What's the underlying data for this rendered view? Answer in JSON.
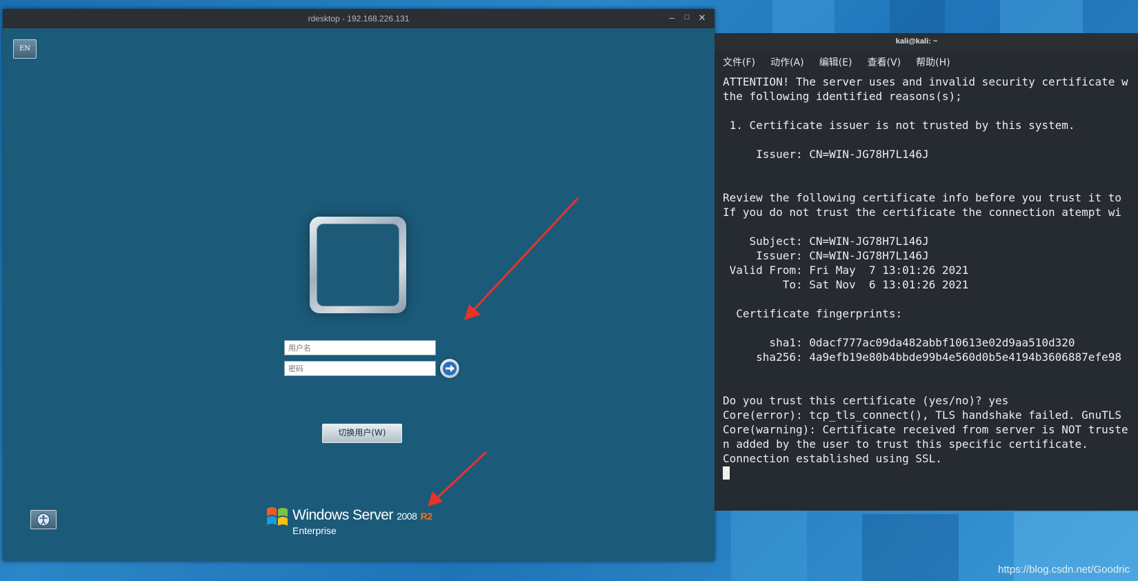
{
  "rdesktop": {
    "title": "rdesktop - 192.168.226.131",
    "controls": {
      "minimize": "–",
      "maximize": "□",
      "close": "✕"
    },
    "lang_button": "EN",
    "username_placeholder": "用户名",
    "password_placeholder": "密码",
    "switch_user_label": "切换用户(W)",
    "brand": {
      "name": "Windows Server",
      "version": "2008",
      "release": "R2",
      "edition": "Enterprise"
    }
  },
  "terminal": {
    "title": "kali@kali: ~",
    "menu": [
      "文件(F)",
      "动作(A)",
      "编辑(E)",
      "查看(V)",
      "帮助(H)"
    ],
    "lines": [
      "ATTENTION! The server uses and invalid security certificate w",
      "the following identified reasons(s);",
      "",
      " 1. Certificate issuer is not trusted by this system.",
      "",
      "     Issuer: CN=WIN-JG78H7L146J",
      "",
      "",
      "Review the following certificate info before you trust it to",
      "If you do not trust the certificate the connection atempt wi",
      "",
      "    Subject: CN=WIN-JG78H7L146J",
      "     Issuer: CN=WIN-JG78H7L146J",
      " Valid From: Fri May  7 13:01:26 2021",
      "         To: Sat Nov  6 13:01:26 2021",
      "",
      "  Certificate fingerprints:",
      "",
      "       sha1: 0dacf777ac09da482abbf10613e02d9aa510d320",
      "     sha256: 4a9efb19e80b4bbde99b4e560d0b5e4194b3606887efe98",
      "",
      "",
      "Do you trust this certificate (yes/no)? yes",
      "Core(error): tcp_tls_connect(), TLS handshake failed. GnuTLS",
      "Core(warning): Certificate received from server is NOT truste",
      "n added by the user to trust this specific certificate.",
      "Connection established using SSL."
    ]
  },
  "watermark": "https://blog.csdn.net/Goodric",
  "colors": {
    "annotation_arrow": "#e8332a",
    "login_background": "#1b5a79",
    "terminal_background": "#262a31"
  }
}
